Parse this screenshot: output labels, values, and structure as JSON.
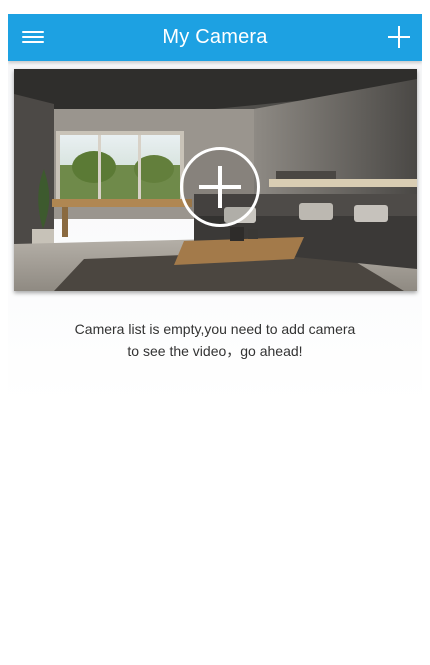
{
  "header": {
    "title": "My Camera",
    "menu_icon": "hamburger-menu-icon",
    "add_icon": "plus-icon",
    "background_color": "#1da1e2"
  },
  "banner": {
    "image": "living-room-photo",
    "overlay_icon": "add-circle-icon"
  },
  "empty_state": {
    "line1": "Camera list is empty,you need to add camera",
    "line2": "to see the video，go ahead!"
  }
}
